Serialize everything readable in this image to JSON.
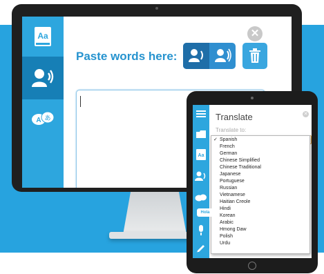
{
  "colors": {
    "brand_blue": "#27a3df",
    "sidebar_blue": "#2da6de",
    "active_blue": "#167fb6",
    "heading_blue": "#2693cf"
  },
  "desktop": {
    "sidebar": [
      {
        "icon": "dictionary-icon",
        "label": "Aa"
      },
      {
        "icon": "speak-icon",
        "active": true
      },
      {
        "icon": "translate-icon",
        "label": "A",
        "label2": "あ"
      }
    ],
    "paste_label": "Paste words here:",
    "close_icon": "close-icon",
    "buttons": [
      "speak-selected-icon",
      "speak-all-icon",
      "trash-icon"
    ]
  },
  "tablet": {
    "title": "Translate",
    "translate_to_label": "Translate to:",
    "hola_badge": "Hola",
    "sidebar_icons": [
      "list-icon",
      "folder-icon",
      "dictionary-icon",
      "speak-icon",
      "translate-icon",
      "microphone-icon",
      "pen-icon"
    ],
    "dictionary_label": "Aa",
    "languages": [
      {
        "name": "Spanish",
        "selected": true,
        "check": "✓"
      },
      {
        "name": "French"
      },
      {
        "name": "German"
      },
      {
        "name": "Chinese Simplified"
      },
      {
        "name": "Chinese Traditional"
      },
      {
        "name": "Japanese"
      },
      {
        "name": "Portuguese"
      },
      {
        "name": "Russian"
      },
      {
        "name": "Vietnamese"
      },
      {
        "name": "Haitian Creole"
      },
      {
        "name": "Hindi"
      },
      {
        "name": "Korean"
      },
      {
        "name": "Arabic"
      },
      {
        "name": "Hmong Daw"
      },
      {
        "name": "Polish"
      },
      {
        "name": "Urdu"
      }
    ]
  }
}
